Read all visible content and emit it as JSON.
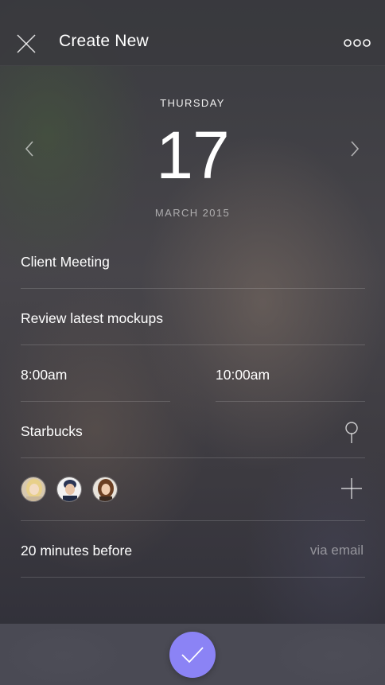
{
  "header": {
    "title": "Create New",
    "close_icon": "close-icon",
    "more_icon": "more-icon"
  },
  "date": {
    "weekday": "THURSDAY",
    "day": "17",
    "month_year": "MARCH 2015",
    "prev_icon": "chevron-left-icon",
    "next_icon": "chevron-right-icon"
  },
  "form": {
    "title": "Client Meeting",
    "description": "Review latest mockups",
    "start_time": "8:00am",
    "end_time": "10:00am",
    "location": "Starbucks",
    "location_icon": "location-pin-icon",
    "attendees": [
      {
        "name": "attendee-1"
      },
      {
        "name": "attendee-2"
      },
      {
        "name": "attendee-3"
      }
    ],
    "add_icon": "add-icon",
    "reminder": "20 minutes before",
    "reminder_method": "via email"
  },
  "footer": {
    "confirm_icon": "checkmark-icon",
    "accent": "#8b83f5"
  }
}
